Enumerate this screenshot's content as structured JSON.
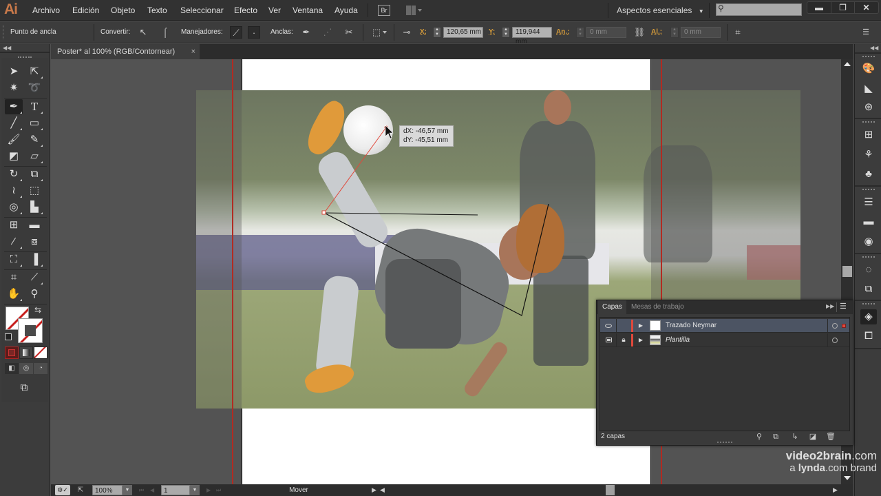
{
  "app": {
    "logo": "Ai",
    "menu": [
      "Archivo",
      "Edición",
      "Objeto",
      "Texto",
      "Seleccionar",
      "Efecto",
      "Ver",
      "Ventana",
      "Ayuda"
    ],
    "bridge_label": "Br",
    "workspace": "Aspectos esenciales",
    "search_placeholder": "",
    "window_controls": [
      "minimize",
      "restore",
      "close"
    ]
  },
  "control_bar": {
    "mode_label": "Punto de ancla",
    "convert_label": "Convertir:",
    "handles_label": "Manejadores:",
    "anchors_label": "Anclas:",
    "x_label": "X:",
    "x_value": "120,65 mm",
    "y_label": "Y:",
    "y_value": "119,944 mm",
    "width_label": "An.:",
    "width_value": "0 mm",
    "height_label": "Al.:",
    "height_value": "0 mm"
  },
  "document": {
    "tab_title": "Poster* al 100% (RGB/Contornear)",
    "close_glyph": "×"
  },
  "canvas": {
    "measure_tooltip": {
      "dx": "dX: -46,57 mm",
      "dy": "dY: -45,51 mm"
    },
    "guide_color": "#b22b22",
    "anchor_color": "#e0493c"
  },
  "toolbox": {
    "tools": [
      "selection-tool",
      "direct-selection-tool",
      "magic-wand-tool",
      "lasso-tool",
      "pen-tool",
      "type-tool",
      "line-segment-tool",
      "rectangle-tool",
      "paintbrush-tool",
      "pencil-tool",
      "blob-brush-tool",
      "eraser-tool",
      "rotate-tool",
      "scale-tool",
      "width-tool",
      "free-transform-tool",
      "shape-builder-tool",
      "column-graph-tool",
      "mesh-tool",
      "gradient-tool",
      "eyedropper-tool",
      "blend-tool",
      "symbol-sprayer-tool",
      "bar-graph-tool",
      "artboard-tool",
      "slice-tool",
      "hand-tool",
      "zoom-tool"
    ],
    "active_tool": "pen-tool"
  },
  "status_bar": {
    "zoom": "100%",
    "artboard_number": "1",
    "status_text": "Mover"
  },
  "layers_panel": {
    "tabs": [
      "Capas",
      "Mesas de trabajo"
    ],
    "active_tab": "Capas",
    "layers": [
      {
        "name": "Trazado Neymar",
        "visible": true,
        "locked": false,
        "selected": true,
        "italic": false
      },
      {
        "name": "Plantilla",
        "visible": true,
        "locked": true,
        "selected": false,
        "italic": true
      }
    ],
    "count_label": "2 capas"
  },
  "right_dock": {
    "icons": [
      "color-icon",
      "color-guide-icon",
      "color-themes-icon",
      "swatches-icon",
      "brushes-icon",
      "symbols-icon",
      "stroke-icon",
      "gradient-icon",
      "transparency-icon",
      "appearance-icon",
      "graphic-styles-icon",
      "layers-icon",
      "artboards-icon"
    ],
    "active": "layers-icon"
  },
  "watermark": {
    "line1_bold": "video2brain",
    "line1_rest": ".com",
    "line2_pre": "a ",
    "line2_bold": "lynda",
    "line2_rest": ".com brand"
  }
}
